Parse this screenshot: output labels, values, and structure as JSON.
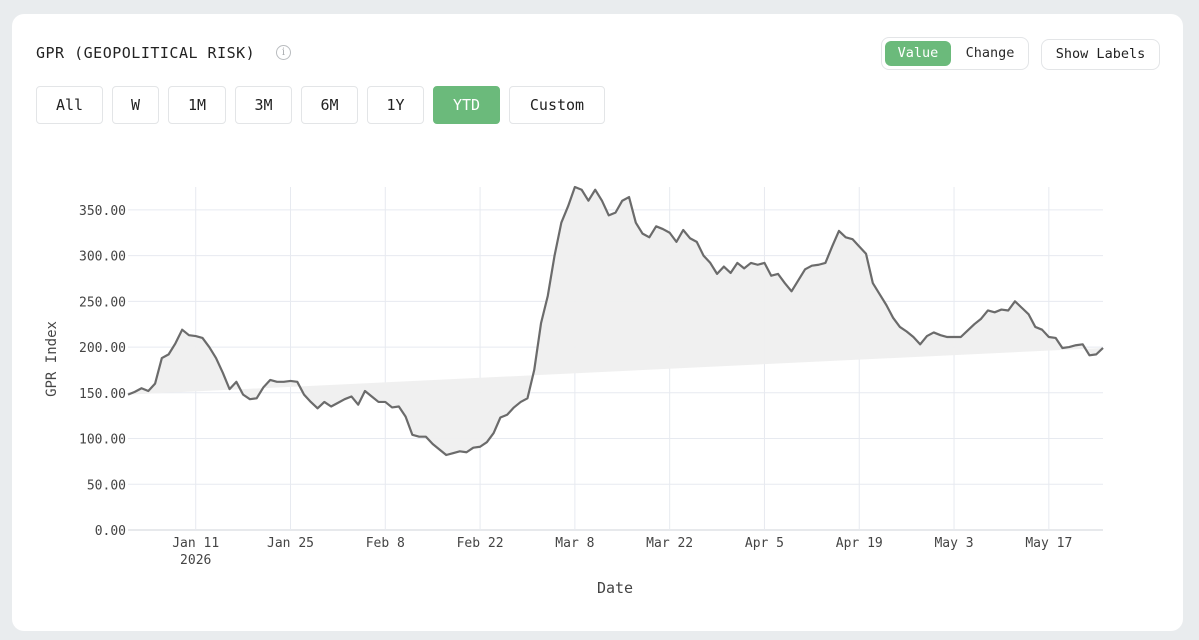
{
  "header": {
    "title": "GPR (GEOPOLITICAL RISK)",
    "info_icon": "info-circle-icon"
  },
  "mode_toggle": {
    "value_label": "Value",
    "change_label": "Change",
    "selected": "Value"
  },
  "show_labels_label": "Show Labels",
  "ranges": [
    "All",
    "W",
    "1M",
    "3M",
    "6M",
    "1Y",
    "YTD",
    "Custom"
  ],
  "selected_range": "YTD",
  "colors": {
    "accent": "#6bba7b",
    "line": "#6b6b6b",
    "fill": "#efefef",
    "grid": "#e7eaf0"
  },
  "chart_data": {
    "type": "area",
    "xlabel": "Date",
    "ylabel": "GPR Index",
    "ylim": [
      0,
      375
    ],
    "yticks": [
      "0.00",
      "50.00",
      "100.00",
      "150.00",
      "200.00",
      "250.00",
      "300.00",
      "350.00"
    ],
    "ytick_values": [
      0,
      50,
      100,
      150,
      200,
      250,
      300,
      350
    ],
    "xticks": [
      {
        "date": "2026-01-11",
        "label": "Jan 11",
        "sublabel": "2026"
      },
      {
        "date": "2026-01-25",
        "label": "Jan 25"
      },
      {
        "date": "2026-02-08",
        "label": "Feb 8"
      },
      {
        "date": "2026-02-22",
        "label": "Feb 22"
      },
      {
        "date": "2026-03-08",
        "label": "Mar 8"
      },
      {
        "date": "2026-03-22",
        "label": "Mar 22"
      },
      {
        "date": "2026-04-05",
        "label": "Apr 5"
      },
      {
        "date": "2026-04-19",
        "label": "Apr 19"
      },
      {
        "date": "2026-05-03",
        "label": "May 3"
      },
      {
        "date": "2026-05-17",
        "label": "May 17"
      }
    ],
    "grid": true,
    "x_range": [
      "2026-01-01",
      "2026-05-25"
    ],
    "x": [
      "2026-01-01",
      "2026-01-02",
      "2026-01-03",
      "2026-01-04",
      "2026-01-05",
      "2026-01-06",
      "2026-01-07",
      "2026-01-08",
      "2026-01-09",
      "2026-01-10",
      "2026-01-11",
      "2026-01-12",
      "2026-01-13",
      "2026-01-14",
      "2026-01-15",
      "2026-01-16",
      "2026-01-17",
      "2026-01-18",
      "2026-01-19",
      "2026-01-20",
      "2026-01-21",
      "2026-01-22",
      "2026-01-23",
      "2026-01-24",
      "2026-01-25",
      "2026-01-26",
      "2026-01-27",
      "2026-01-28",
      "2026-01-29",
      "2026-01-30",
      "2026-01-31",
      "2026-02-01",
      "2026-02-02",
      "2026-02-03",
      "2026-02-04",
      "2026-02-05",
      "2026-02-06",
      "2026-02-07",
      "2026-02-08",
      "2026-02-09",
      "2026-02-10",
      "2026-02-11",
      "2026-02-12",
      "2026-02-13",
      "2026-02-14",
      "2026-02-15",
      "2026-02-16",
      "2026-02-17",
      "2026-02-18",
      "2026-02-19",
      "2026-02-20",
      "2026-02-21",
      "2026-02-22",
      "2026-02-23",
      "2026-02-24",
      "2026-02-25",
      "2026-02-26",
      "2026-02-27",
      "2026-02-28",
      "2026-03-01",
      "2026-03-02",
      "2026-03-03",
      "2026-03-04",
      "2026-03-05",
      "2026-03-06",
      "2026-03-07",
      "2026-03-08",
      "2026-03-09",
      "2026-03-10",
      "2026-03-11",
      "2026-03-12",
      "2026-03-13",
      "2026-03-14",
      "2026-03-15",
      "2026-03-16",
      "2026-03-17",
      "2026-03-18",
      "2026-03-19",
      "2026-03-20",
      "2026-03-21",
      "2026-03-22",
      "2026-03-23",
      "2026-03-24",
      "2026-03-25",
      "2026-03-26",
      "2026-03-27",
      "2026-03-28",
      "2026-03-29",
      "2026-03-30",
      "2026-03-31",
      "2026-04-01",
      "2026-04-02",
      "2026-04-03",
      "2026-04-04",
      "2026-04-05",
      "2026-04-06",
      "2026-04-07",
      "2026-04-08",
      "2026-04-09",
      "2026-04-10",
      "2026-04-11",
      "2026-04-12",
      "2026-04-13",
      "2026-04-14",
      "2026-04-15",
      "2026-04-16",
      "2026-04-17",
      "2026-04-18",
      "2026-04-19",
      "2026-04-20",
      "2026-04-21",
      "2026-04-22",
      "2026-04-23",
      "2026-04-24",
      "2026-04-25",
      "2026-04-26",
      "2026-04-27",
      "2026-04-28",
      "2026-04-29",
      "2026-04-30",
      "2026-05-01",
      "2026-05-02",
      "2026-05-03",
      "2026-05-04",
      "2026-05-05",
      "2026-05-06",
      "2026-05-07",
      "2026-05-08",
      "2026-05-09",
      "2026-05-10",
      "2026-05-11",
      "2026-05-12",
      "2026-05-13",
      "2026-05-14",
      "2026-05-15",
      "2026-05-16",
      "2026-05-17",
      "2026-05-18",
      "2026-05-19",
      "2026-05-20",
      "2026-05-21",
      "2026-05-22",
      "2026-05-23",
      "2026-05-24",
      "2026-05-25"
    ],
    "series": [
      {
        "values": [
          148,
          151,
          155,
          152,
          160,
          188,
          192,
          204,
          219,
          213,
          212,
          210,
          200,
          188,
          172,
          154,
          162,
          148,
          143,
          144,
          156,
          164,
          162,
          162,
          163,
          162,
          148,
          140,
          133,
          140,
          135,
          139,
          143,
          146,
          137,
          152,
          146,
          140,
          140,
          134,
          135,
          124,
          104,
          102,
          102,
          94,
          88,
          82,
          84,
          86,
          85,
          90,
          91,
          96,
          106,
          123,
          126,
          134,
          140,
          144,
          175,
          226,
          256,
          300,
          336,
          354,
          375,
          372,
          360,
          372,
          360,
          344,
          347,
          360,
          364,
          336,
          324,
          320,
          332,
          329,
          325,
          315,
          328,
          319,
          315,
          300,
          292,
          280,
          288,
          281,
          292,
          286,
          292,
          290,
          292,
          278,
          280,
          270,
          261,
          273,
          285,
          289,
          290,
          292,
          310,
          327,
          320,
          318,
          310,
          302,
          270,
          258,
          246,
          232,
          222,
          217,
          211,
          203,
          212,
          216,
          213,
          211,
          211,
          211,
          218,
          225,
          231,
          240,
          238,
          241,
          240,
          250,
          243,
          236,
          222,
          219,
          211,
          210,
          199,
          200,
          202,
          203,
          191,
          192,
          199,
          195,
          187
        ]
      }
    ]
  }
}
